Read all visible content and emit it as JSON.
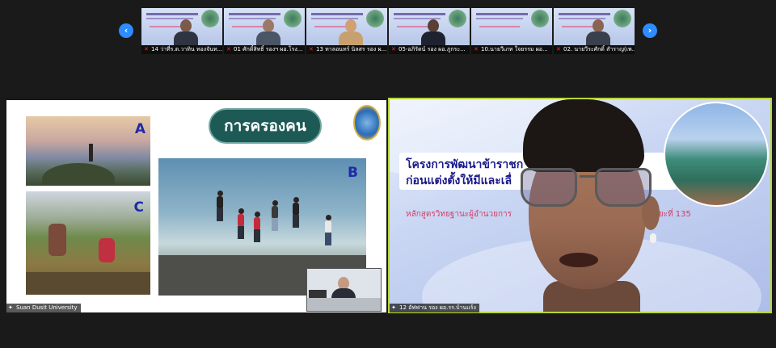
{
  "filmstrip": {
    "prev_icon": "chevron-left-icon",
    "next_icon": "chevron-right-icon",
    "prev_glyph": "‹",
    "next_glyph": "›",
    "participants": [
      {
        "name": "14 ว่าที่ร.ต.วาทิน ทองจันท..."
      },
      {
        "name": "01 ศักดิ์สิทธิ์ รองฯ ผอ.โรง..."
      },
      {
        "name": "13 ทาลอนทร์ นิลสร รอง ผ..."
      },
      {
        "name": "05-อภิรัตน์ รอง ผอ.ภูกระ..."
      },
      {
        "name": "10.นายวีเภท ใจยรรม ผอ..."
      },
      {
        "name": "02. นายวีระศักดิ์ สำราญ(เพ..."
      }
    ],
    "accent_color": "#2d8cff"
  },
  "shared_screen": {
    "slide_title": "การครองคน",
    "photo_labels": [
      "A",
      "B",
      "C"
    ],
    "owner_label": "Suan Dusit University"
  },
  "active_speaker": {
    "slide_line1": "โครงการพัฒนาข้าราชก",
    "slide_line2": "ก่อนแต่งตั้งให้มีและเลื่",
    "slide_sub_left": "หลักสูตรวิทยฐานะผู้อำนวยการ",
    "slide_sub_right": "ระยะที่ 135",
    "name_label": "12 อัฟฟาน รอง ผอ.รร.บ้านแร้ง",
    "highlight_color": "#b8d63a"
  }
}
